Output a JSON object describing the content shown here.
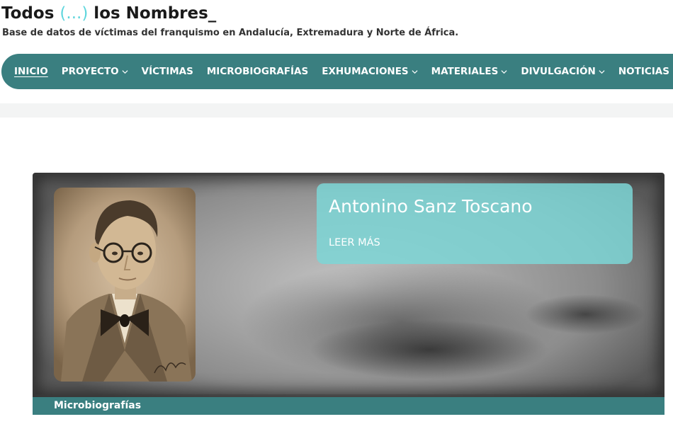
{
  "header": {
    "title_pre": "Todos ",
    "title_ellipsis": "(...)",
    "title_post": " los Nombres_",
    "tagline": "Base de datos de víctimas del franquismo en Andalucía, Extremadura y Norte de África."
  },
  "nav": {
    "items": [
      {
        "label": "INICIO",
        "dropdown": false,
        "active": true
      },
      {
        "label": "PROYECTO",
        "dropdown": true,
        "active": false
      },
      {
        "label": "VÍCTIMAS",
        "dropdown": false,
        "active": false
      },
      {
        "label": "MICROBIOGRAFÍAS",
        "dropdown": false,
        "active": false
      },
      {
        "label": "EXHUMACIONES",
        "dropdown": true,
        "active": false
      },
      {
        "label": "MATERIALES",
        "dropdown": true,
        "active": false
      },
      {
        "label": "DIVULGACIÓN",
        "dropdown": true,
        "active": false
      },
      {
        "label": "NOTICIAS",
        "dropdown": false,
        "active": false
      }
    ]
  },
  "slide": {
    "name": "Antonino Sanz Toscano",
    "read_more": "LEER MÁS",
    "category": "Microbiografías"
  },
  "colors": {
    "nav_bg": "#3a7f80",
    "accent": "#5fd6dd",
    "caption_bg": "#7dd6d6"
  }
}
